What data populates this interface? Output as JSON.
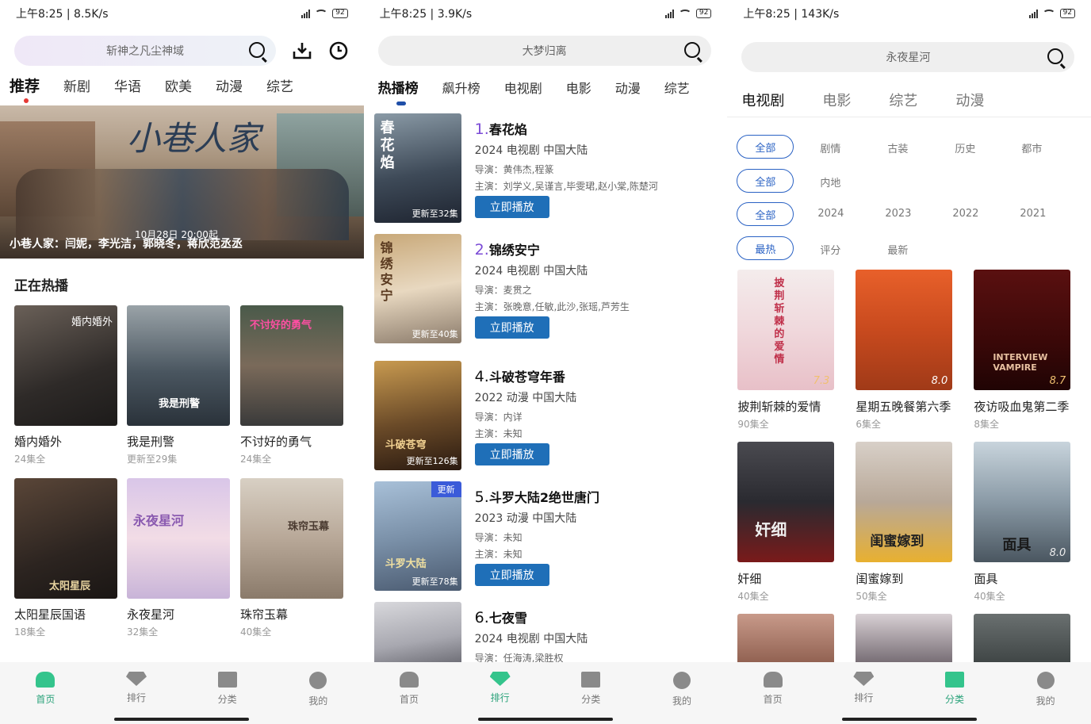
{
  "screens": [
    {
      "status": {
        "left": "上午8:25 | 8.5K/s",
        "battery": "92"
      },
      "search": {
        "placeholder": "斩神之凡尘神域"
      },
      "tabs": [
        "推荐",
        "新剧",
        "华语",
        "欧美",
        "动漫",
        "综艺"
      ],
      "banner": {
        "caption": "小巷人家：闫妮，李光洁，郭晓冬，蒋欣范丞丞",
        "date_text": "10月28日 20:00起"
      },
      "section_title": "正在热播",
      "items": [
        {
          "title": "婚内婚外",
          "sub": "24集全"
        },
        {
          "title": "我是刑警",
          "sub": "更新至29集"
        },
        {
          "title": "不讨好的勇气",
          "sub": "24集全"
        },
        {
          "title": "太阳星辰国语",
          "sub": "18集全"
        },
        {
          "title": "永夜星河",
          "sub": "32集全"
        },
        {
          "title": "珠帘玉幕",
          "sub": "40集全"
        }
      ],
      "nav": [
        "首页",
        "排行",
        "分类",
        "我的"
      ]
    },
    {
      "status": {
        "left": "上午8:25 | 3.9K/s",
        "battery": "92"
      },
      "search": {
        "placeholder": "大梦归离"
      },
      "tabs": [
        "热播榜",
        "飙升榜",
        "电视剧",
        "电影",
        "动漫",
        "综艺"
      ],
      "items": [
        {
          "num": "1.",
          "title": "春花焰",
          "meta": "2024  电视剧  中国大陆",
          "director": "导演：黄伟杰,程篆",
          "cast": "主演：刘学义,吴谨言,毕雯珺,赵小棠,陈楚河",
          "update": "更新至32集"
        },
        {
          "num": "2.",
          "title": "锦绣安宁",
          "meta": "2024  电视剧  中国大陆",
          "director": "导演：麦贯之",
          "cast": "主演：张晚意,任敏,此沙,张瑶,芦芳生",
          "update": "更新至40集"
        },
        {
          "num": "4.",
          "title": "斗破苍穹年番",
          "meta": "2022  动漫  中国大陆",
          "director": "导演：内详",
          "cast": "主演：未知",
          "update": "更新至126集"
        },
        {
          "num": "5.",
          "title": "斗罗大陆2绝世唐门",
          "meta": "2023  动漫  中国大陆",
          "director": "导演：未知",
          "cast": "主演：未知",
          "update": "更新至78集",
          "tag": "更新"
        },
        {
          "num": "6.",
          "title": "七夜雪",
          "meta": "2024  电视剧  中国大陆",
          "director": "导演：任海涛,梁胜权"
        }
      ],
      "play_label": "立即播放",
      "nav": [
        "首页",
        "排行",
        "分类",
        "我的"
      ]
    },
    {
      "status": {
        "left": "上午8:25 | 143K/s",
        "battery": "92"
      },
      "search": {
        "placeholder": "永夜星河"
      },
      "tabs": [
        "电视剧",
        "电影",
        "综艺",
        "动漫"
      ],
      "filters": [
        {
          "pill": "全部",
          "opts": [
            "剧情",
            "古装",
            "历史",
            "都市"
          ]
        },
        {
          "pill": "全部",
          "opts": [
            "内地"
          ]
        },
        {
          "pill": "全部",
          "opts": [
            "2024",
            "2023",
            "2022",
            "2021"
          ]
        },
        {
          "pill": "最热",
          "opts": [
            "评分",
            "最新"
          ]
        }
      ],
      "items": [
        {
          "title": "披荆斩棘的爱情",
          "sub": "90集全",
          "score": "7.3"
        },
        {
          "title": "星期五晚餐第六季",
          "sub": "6集全",
          "score": "8.0"
        },
        {
          "title": "夜访吸血鬼第二季",
          "sub": "8集全",
          "score": "8.7"
        },
        {
          "title": "奸细",
          "sub": "40集全",
          "score": ""
        },
        {
          "title": "闺蜜嫁到",
          "sub": "50集全",
          "score": ""
        },
        {
          "title": "面具",
          "sub": "40集全",
          "score": "8.0"
        }
      ],
      "nav": [
        "首页",
        "排行",
        "分类",
        "我的"
      ]
    }
  ],
  "colors": {
    "accent_green": "#34c48c",
    "play_blue": "#1f6fb8",
    "rank_purple": "#7b4bd6",
    "pill_blue": "#2a62c4"
  }
}
